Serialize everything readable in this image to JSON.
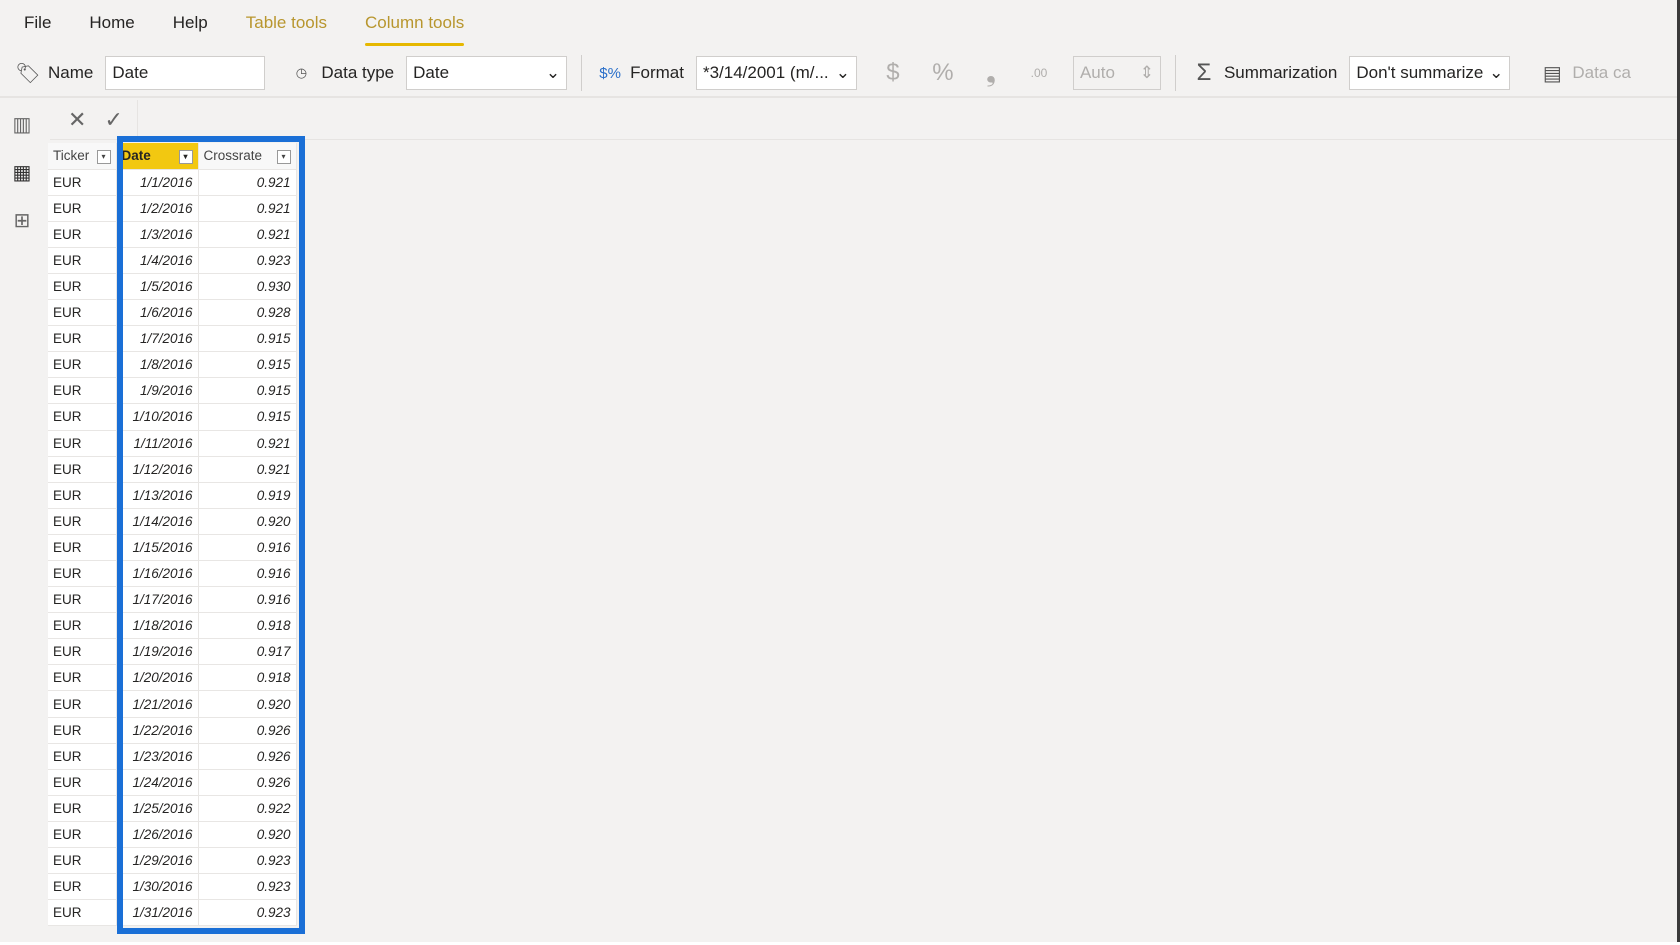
{
  "menu": {
    "file": "File",
    "home": "Home",
    "help": "Help",
    "table_tools": "Table tools",
    "column_tools": "Column tools"
  },
  "toolbar": {
    "name_label": "Name",
    "name_value": "Date",
    "data_type_label": "Data type",
    "data_type_value": "Date",
    "format_label": "Format",
    "format_value": "*3/14/2001 (m/...",
    "decimal_value": "Auto",
    "summarization_label": "Summarization",
    "summarization_value": "Don't summarize",
    "data_category_label": "Data ca"
  },
  "accent": "#f2c811",
  "highlight_color": "#1a6fd6",
  "table": {
    "headers": [
      "Ticker",
      "Date",
      "Crossrate"
    ],
    "rows": [
      [
        "EUR",
        "1/1/2016",
        "0.921"
      ],
      [
        "EUR",
        "1/2/2016",
        "0.921"
      ],
      [
        "EUR",
        "1/3/2016",
        "0.921"
      ],
      [
        "EUR",
        "1/4/2016",
        "0.923"
      ],
      [
        "EUR",
        "1/5/2016",
        "0.930"
      ],
      [
        "EUR",
        "1/6/2016",
        "0.928"
      ],
      [
        "EUR",
        "1/7/2016",
        "0.915"
      ],
      [
        "EUR",
        "1/8/2016",
        "0.915"
      ],
      [
        "EUR",
        "1/9/2016",
        "0.915"
      ],
      [
        "EUR",
        "1/10/2016",
        "0.915"
      ],
      [
        "EUR",
        "1/11/2016",
        "0.921"
      ],
      [
        "EUR",
        "1/12/2016",
        "0.921"
      ],
      [
        "EUR",
        "1/13/2016",
        "0.919"
      ],
      [
        "EUR",
        "1/14/2016",
        "0.920"
      ],
      [
        "EUR",
        "1/15/2016",
        "0.916"
      ],
      [
        "EUR",
        "1/16/2016",
        "0.916"
      ],
      [
        "EUR",
        "1/17/2016",
        "0.916"
      ],
      [
        "EUR",
        "1/18/2016",
        "0.918"
      ],
      [
        "EUR",
        "1/19/2016",
        "0.917"
      ],
      [
        "EUR",
        "1/20/2016",
        "0.918"
      ],
      [
        "EUR",
        "1/21/2016",
        "0.920"
      ],
      [
        "EUR",
        "1/22/2016",
        "0.926"
      ],
      [
        "EUR",
        "1/23/2016",
        "0.926"
      ],
      [
        "EUR",
        "1/24/2016",
        "0.926"
      ],
      [
        "EUR",
        "1/25/2016",
        "0.922"
      ],
      [
        "EUR",
        "1/26/2016",
        "0.920"
      ],
      [
        "EUR",
        "1/29/2016",
        "0.923"
      ],
      [
        "EUR",
        "1/30/2016",
        "0.923"
      ],
      [
        "EUR",
        "1/31/2016",
        "0.923"
      ]
    ]
  }
}
